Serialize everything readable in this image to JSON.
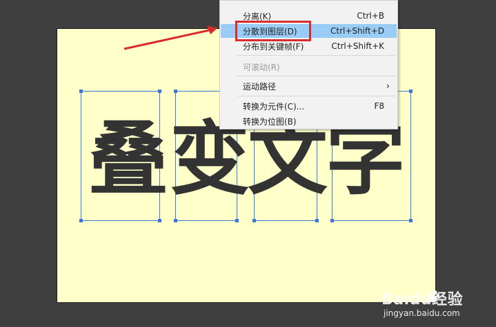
{
  "canvas": {
    "glyphs": [
      "叠",
      "变",
      "文",
      "字"
    ]
  },
  "context_menu": {
    "items": [
      {
        "label": "分离(K)",
        "shortcut": "Ctrl+B"
      },
      {
        "label": "分散到图层(D)",
        "shortcut": "Ctrl+Shift+D"
      },
      {
        "label": "分布到关键帧(F)",
        "shortcut": "Ctrl+Shift+K"
      },
      {
        "label": "可滚动(R)",
        "shortcut": ""
      },
      {
        "label": "运动路径",
        "shortcut": ""
      },
      {
        "label": "转换为元件(C)...",
        "shortcut": "F8"
      },
      {
        "label": "转换为位图(B)",
        "shortcut": ""
      }
    ]
  },
  "watermark": {
    "brand": "Baidu经验",
    "url": "jingyan.baidu.com"
  },
  "colors": {
    "background": "#3f3f3f",
    "stage": "#ffffc9",
    "highlight_red": "#d62c2c",
    "menu_selected": "#99cdf5",
    "selection_blue": "#3c77d8"
  }
}
